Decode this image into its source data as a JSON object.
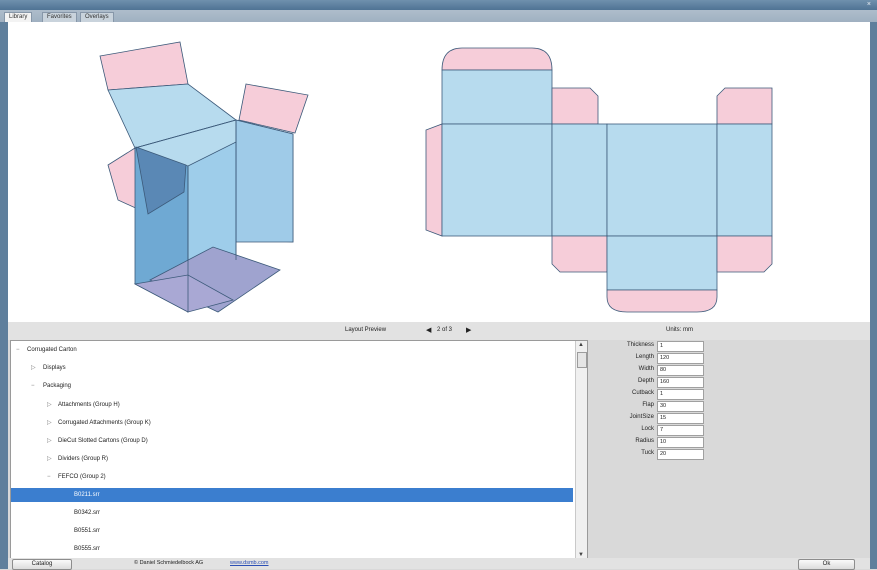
{
  "window": {
    "close_glyph": "×"
  },
  "tabs": [
    {
      "label": "Library"
    },
    {
      "label": "Favorites"
    },
    {
      "label": "Overlays"
    }
  ],
  "layout_preview": {
    "label": "Layout Preview",
    "prev_glyph": "◀",
    "page": "2 of 3",
    "next_glyph": "▶"
  },
  "units": {
    "label": "Units: mm"
  },
  "tree": {
    "items": [
      {
        "label": "Corrugated Carton",
        "toggle": "−",
        "selected": false
      },
      {
        "label": "Displays",
        "toggle": "▷",
        "selected": false
      },
      {
        "label": "Packaging",
        "toggle": "−",
        "selected": false
      },
      {
        "label": "Attachments (Group H)",
        "toggle": "▷",
        "selected": false
      },
      {
        "label": "Corrugated Attachments (Group K)",
        "toggle": "▷",
        "selected": false
      },
      {
        "label": "DieCut Slotted Cartons (Group D)",
        "toggle": "▷",
        "selected": false
      },
      {
        "label": "Dividers (Group R)",
        "toggle": "▷",
        "selected": false
      },
      {
        "label": "FEFCO (Group 2)",
        "toggle": "−",
        "selected": false
      },
      {
        "label": "B0211.srr",
        "toggle": "",
        "selected": true
      },
      {
        "label": "B0342.srr",
        "toggle": "",
        "selected": false
      },
      {
        "label": "B0551.srr",
        "toggle": "",
        "selected": false
      },
      {
        "label": "B0555.srr",
        "toggle": "",
        "selected": false
      }
    ],
    "scroll_up_glyph": "▲",
    "scroll_down_glyph": "▼"
  },
  "params": [
    {
      "label": "Thickness",
      "value": "1"
    },
    {
      "label": "Length",
      "value": "120"
    },
    {
      "label": "Width",
      "value": "80"
    },
    {
      "label": "Depth",
      "value": "160"
    },
    {
      "label": "Cutback",
      "value": "1"
    },
    {
      "label": "Flap",
      "value": "30"
    },
    {
      "label": "JointSize",
      "value": "15"
    },
    {
      "label": "Lock",
      "value": "7"
    },
    {
      "label": "Radius",
      "value": "10"
    },
    {
      "label": "Tuck",
      "value": "20"
    }
  ],
  "buttons": {
    "catalog": "Catalog",
    "ok": "Ok"
  },
  "footer": {
    "copyright": "© Daniel Schmiedelbock AG",
    "link": "www.dsmb.com"
  },
  "colors": {
    "panel_blue": "#b7dbee",
    "flap_pink": "#f6cdd9",
    "box_blue": "#6fa9d3",
    "selection": "#3b7ecf"
  }
}
